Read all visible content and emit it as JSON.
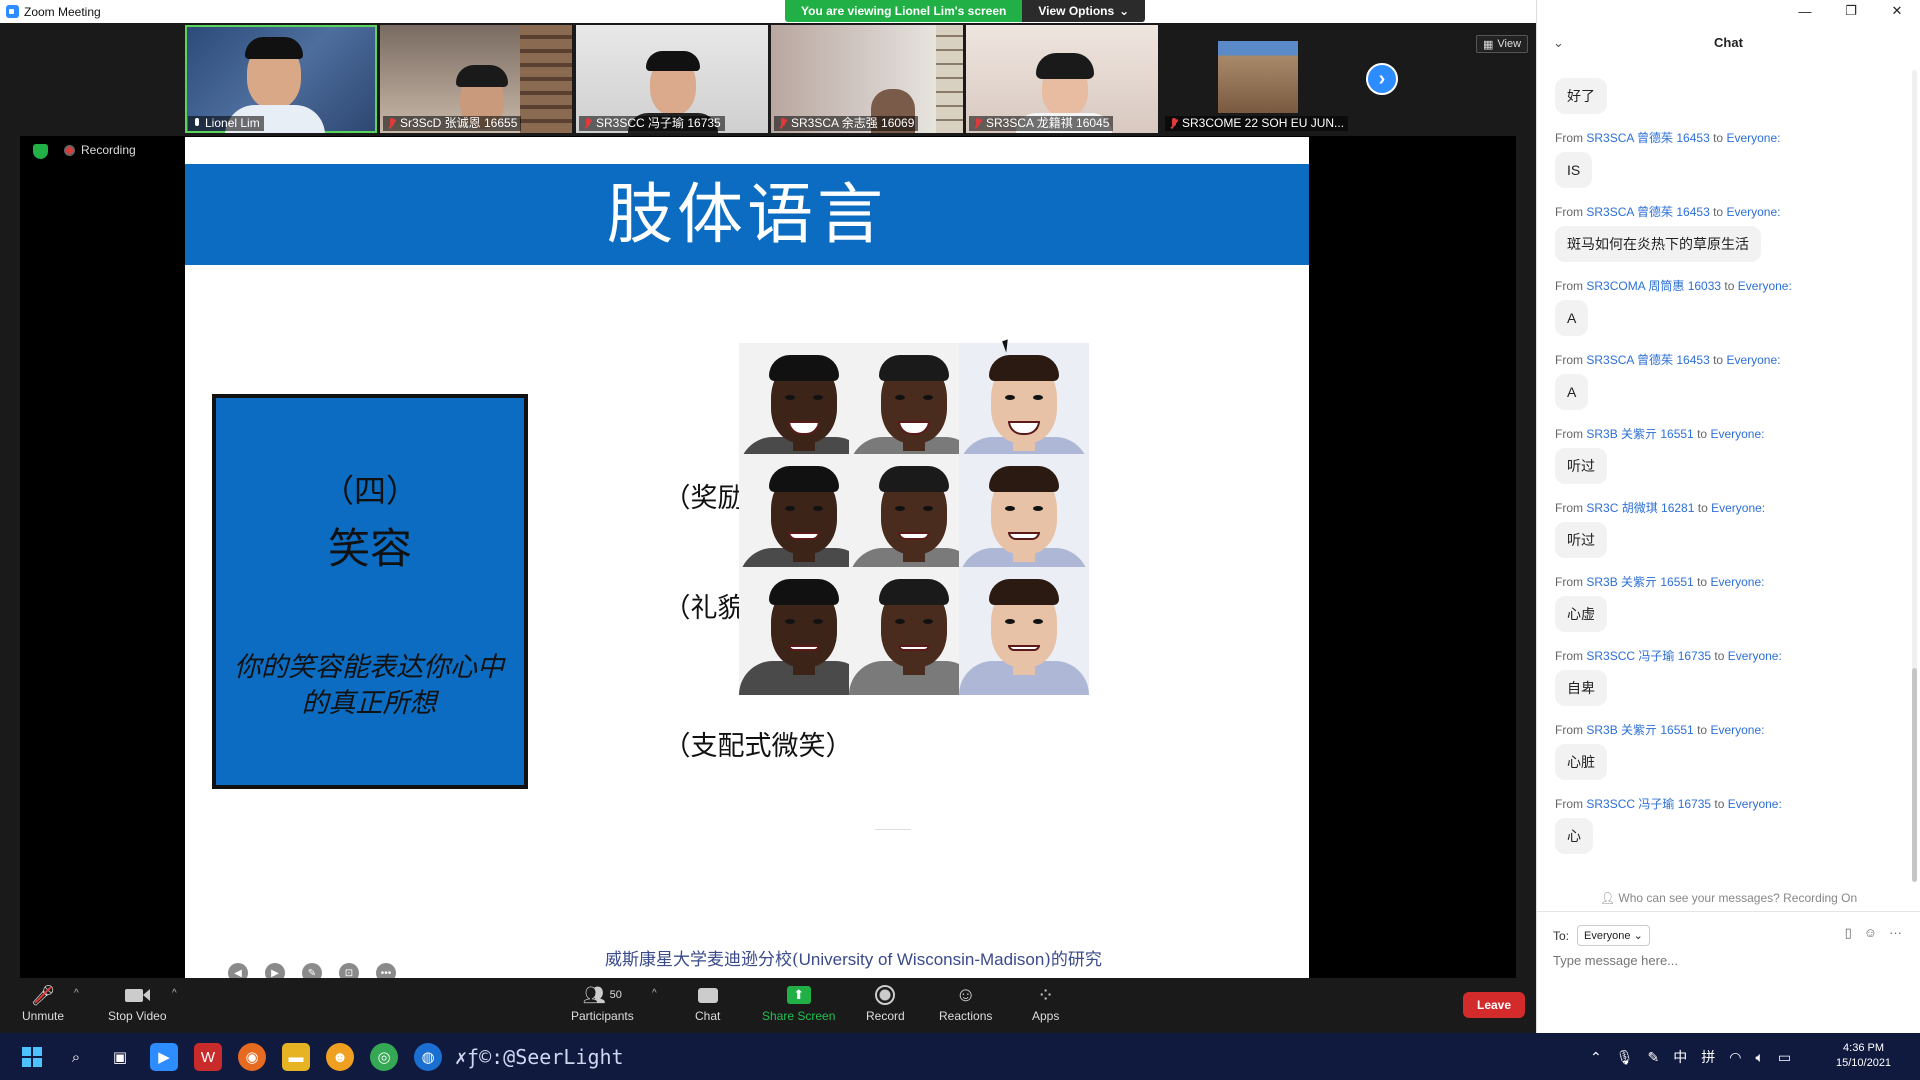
{
  "window": {
    "title": "Zoom Meeting"
  },
  "banner": {
    "viewing": "You are viewing Lionel Lim's screen",
    "options": "View Options"
  },
  "video_strip": {
    "participants": [
      {
        "name": "Lionel Lim",
        "muted": false,
        "active": true
      },
      {
        "name": "Sr3ScD 张诚恩 16655",
        "muted": true
      },
      {
        "name": "SR3SCC 冯子瑜 16735",
        "muted": true
      },
      {
        "name": "SR3SCA 余志强 16069",
        "muted": true
      },
      {
        "name": "SR3SCA 龙籍祺 16045",
        "muted": true
      },
      {
        "name": "SR3COME 22 SOH EU JUN...",
        "muted": true
      }
    ],
    "view_label": "View"
  },
  "recording_label": "Recording",
  "slide": {
    "title": "肢体语言",
    "box_number": "（四）",
    "box_title": "笑容",
    "box_quote": "你的笑容能表达你心中的真正所想",
    "smiles": [
      "（奖励式微笑）",
      "（礼貌式微笑）",
      "（支配式微笑）"
    ],
    "credit_pre": "威斯康星大学麦迪逊分校(",
    "credit_latin": "University of Wisconsin-Madison",
    "credit_post": ")的研究"
  },
  "toolbar": {
    "unmute": "Unmute",
    "stop_video": "Stop Video",
    "participants_count": "50",
    "participants": "Participants",
    "chat": "Chat",
    "share_screen": "Share Screen",
    "record": "Record",
    "reactions": "Reactions",
    "apps": "Apps",
    "leave": "Leave"
  },
  "chat": {
    "title": "Chat",
    "messages": [
      {
        "from": "",
        "to": "",
        "text": "好了"
      },
      {
        "from": "SR3SCA 曾德茱 16453",
        "to": "Everyone:",
        "text": "IS"
      },
      {
        "from": "SR3SCA 曾德茱 16453",
        "to": "Everyone:",
        "text": "斑马如何在炎热下的草原生活"
      },
      {
        "from": "SR3COMA 周筒惠 16033",
        "to": "Everyone:",
        "text": "A"
      },
      {
        "from": "SR3SCA 曾德茱 16453",
        "to": "Everyone:",
        "text": "A"
      },
      {
        "from": "SR3B 关紫亓 16551",
        "to": "Everyone:",
        "text": "听过"
      },
      {
        "from": "SR3C 胡微琪 16281",
        "to": "Everyone:",
        "text": "听过"
      },
      {
        "from": "SR3B 关紫亓 16551",
        "to": "Everyone:",
        "text": "心虚"
      },
      {
        "from": "SR3SCC 冯子瑜 16735",
        "to": "Everyone:",
        "text": "自卑"
      },
      {
        "from": "SR3B 关紫亓 16551",
        "to": "Everyone:",
        "text": "心脏"
      },
      {
        "from": "SR3SCC 冯子瑜 16735",
        "to": "Everyone:",
        "text": "心"
      }
    ],
    "from_word": "From",
    "to_word": "to",
    "who_can_see": "Who can see your messages? Recording On",
    "to_label": "To:",
    "recipient": "Everyone",
    "placeholder": "Type message here..."
  },
  "taskbar": {
    "watermark": "✗ƒ©:@SeerLight",
    "ime": "中",
    "ime2": "拼",
    "time": "4:36 PM",
    "date": "15/10/2021"
  }
}
